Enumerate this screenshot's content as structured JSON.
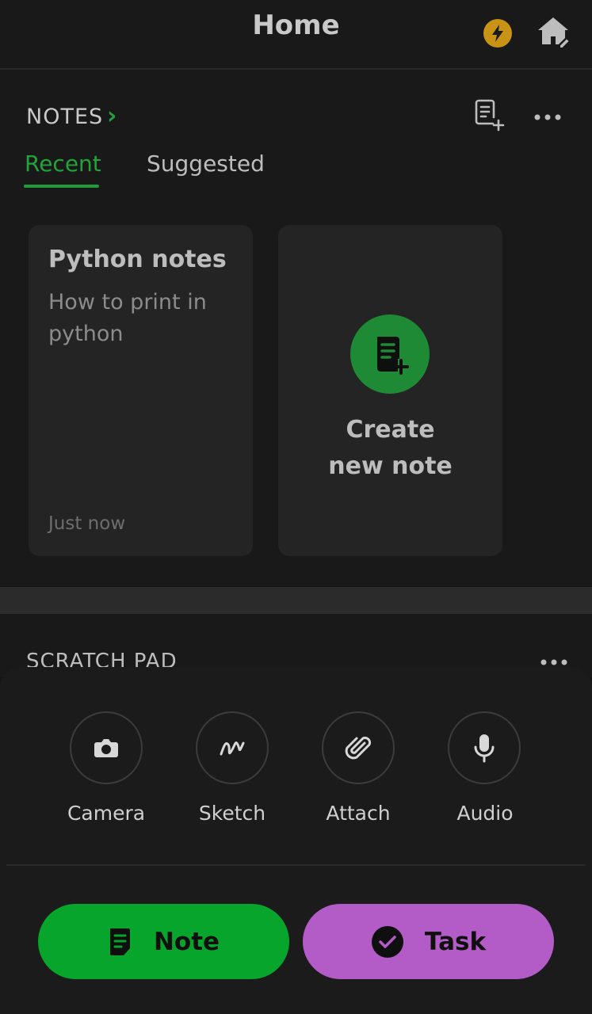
{
  "header": {
    "title": "Home",
    "bolt_color": "#c99315"
  },
  "notes": {
    "section_title": "NOTES",
    "tabs": [
      {
        "label": "Recent",
        "active": true
      },
      {
        "label": "Suggested",
        "active": false
      }
    ],
    "cards": [
      {
        "title": "Python notes",
        "body": "How to print in python",
        "time": "Just now"
      }
    ],
    "create_card": {
      "line1": "Create",
      "line2": "new note"
    }
  },
  "scratch_pad": {
    "title": "SCRATCH PAD"
  },
  "sheet": {
    "actions": [
      {
        "label": "Camera",
        "icon": "camera-icon"
      },
      {
        "label": "Sketch",
        "icon": "sketch-icon"
      },
      {
        "label": "Attach",
        "icon": "paperclip-icon"
      },
      {
        "label": "Audio",
        "icon": "microphone-icon"
      }
    ],
    "note_button": {
      "label": "Note",
      "color": "#07a52c"
    },
    "task_button": {
      "label": "Task",
      "color": "#b35bc7"
    }
  },
  "colors": {
    "accent_green": "#21a33a",
    "background": "#141414",
    "card": "#242424"
  }
}
